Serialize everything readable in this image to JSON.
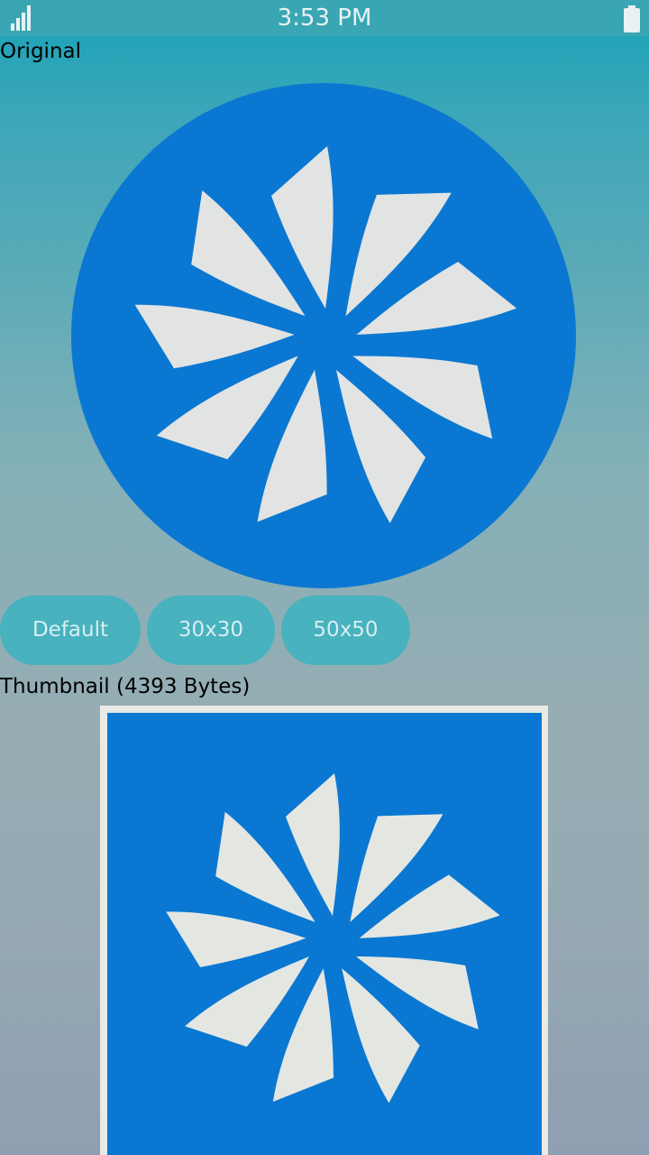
{
  "status_bar": {
    "time": "3:53 PM",
    "signal_icon": "signal-icon",
    "battery_icon": "battery-icon"
  },
  "original": {
    "label": "Original",
    "image_icon": "pinwheel-logo",
    "circle_color": "#0a78d2",
    "petal_color": "#e2e3e3"
  },
  "buttons": {
    "default_label": "Default",
    "size30_label": "30x30",
    "size50_label": "50x50",
    "color": "#48b2bf"
  },
  "thumbnail": {
    "label": "Thumbnail (4393 Bytes)",
    "image_icon": "pinwheel-logo",
    "square_color": "#0a78d2",
    "border_color": "#e9eae6"
  }
}
